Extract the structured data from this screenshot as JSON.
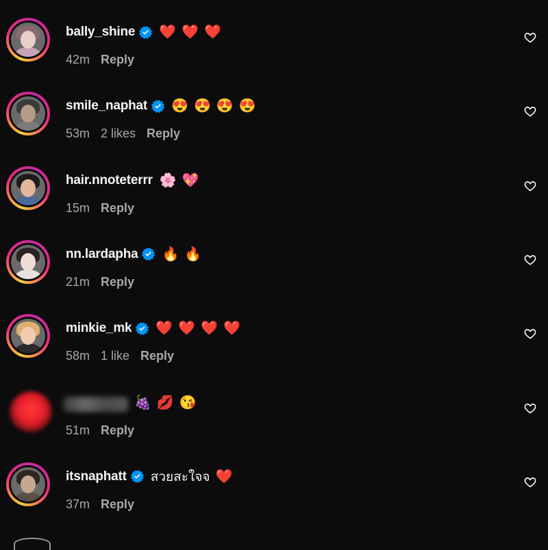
{
  "comments": [
    {
      "username": "bally_shine",
      "verified": true,
      "text": "",
      "emojis": [
        "❤️",
        "❤️",
        "❤️"
      ],
      "time": "42m",
      "likes": "",
      "reply": "Reply",
      "skin": "#e8d0c8",
      "hair": "#8a6a70",
      "body": "#c9a4b6"
    },
    {
      "username": "smile_naphat",
      "verified": true,
      "text": "",
      "emojis": [
        "😍",
        "😍",
        "😍",
        "😍"
      ],
      "time": "53m",
      "likes": "2 likes",
      "reply": "Reply",
      "skin": "#b89b86",
      "hair": "#3a3a3a",
      "body": "#7a7a7a"
    },
    {
      "username": "hair.nnoteterrr",
      "verified": false,
      "text": "",
      "emojis": [
        "🌸",
        "💖"
      ],
      "time": "15m",
      "likes": "",
      "reply": "Reply",
      "skin": "#e2b79c",
      "hair": "#1c1c1c",
      "body": "#4a6a9a"
    },
    {
      "username": "nn.lardapha",
      "verified": true,
      "text": "",
      "emojis": [
        "🔥",
        "🔥"
      ],
      "time": "21m",
      "likes": "",
      "reply": "Reply",
      "skin": "#f0dcd4",
      "hair": "#2a2222",
      "body": "#e9e2e2"
    },
    {
      "username": "minkie_mk",
      "verified": true,
      "text": "",
      "emojis": [
        "❤️",
        "❤️",
        "❤️",
        "❤️"
      ],
      "time": "58m",
      "likes": "1 like",
      "reply": "Reply",
      "skin": "#f0cdb0",
      "hair": "#e0b070",
      "body": "#2a2a2a"
    },
    {
      "username": "",
      "verified": false,
      "text": "",
      "emojis": [
        "🍇",
        "💋",
        "😘"
      ],
      "time": "51m",
      "likes": "",
      "reply": "Reply",
      "blurred": true
    },
    {
      "username": "itsnaphatt",
      "verified": true,
      "text": "สวยสะใจจ",
      "emojis": [
        "❤️"
      ],
      "time": "37m",
      "likes": "",
      "reply": "Reply",
      "skin": "#c4a890",
      "hair": "#2c2520",
      "body": "#5a5048"
    }
  ],
  "icons": {
    "verified": "verified-badge-icon",
    "like": "heart-outline-icon"
  },
  "colors": {
    "background": "#0c0c0c",
    "verified": "#0095f6",
    "secondary_text": "#a8a8a8"
  }
}
